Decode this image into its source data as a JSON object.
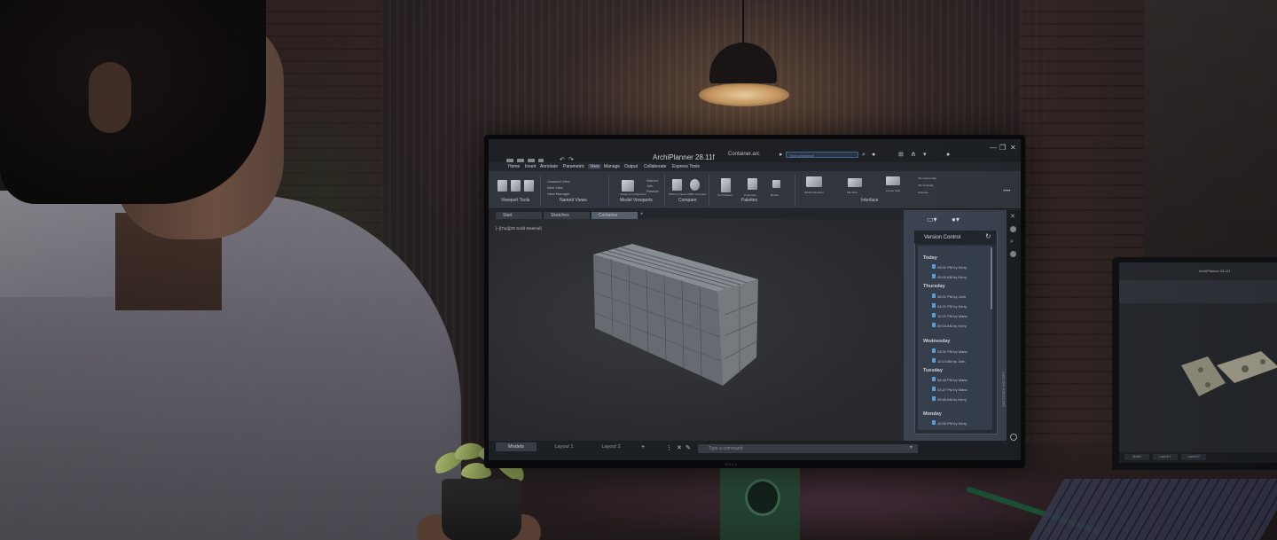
{
  "app": {
    "title": "ArchiPlanner 28.11f",
    "file": "Container.arc",
    "search_placeholder": "Type a keyword",
    "window_controls": [
      "—",
      "❐",
      "✕"
    ]
  },
  "menu": {
    "tabs": [
      "Home",
      "Insert",
      "Annotate",
      "Parametric",
      "View",
      "Manage",
      "Output",
      "Collaborate",
      "Express Tools"
    ],
    "active_tab": "View"
  },
  "ribbon": {
    "viewport_tools_label": "Viewport Tools",
    "named_views": {
      "items": [
        "Unsaved View",
        "New View",
        "View Manager"
      ],
      "label": "Named Views"
    },
    "model_viewports": {
      "label": "Model Viewports",
      "items": [
        "Viewport Configuration",
        "Named",
        "Join",
        "Restore"
      ]
    },
    "compare": {
      "label": "Compare",
      "items": [
        "DWG Compare",
        "XREF Compare"
      ]
    },
    "palettes": {
      "label": "Palettes",
      "items": [
        "Tool Palettes",
        "Properties",
        "Blocks"
      ]
    },
    "interface": {
      "label": "Interface",
      "items": [
        "Switch Windows",
        "File Tabs",
        "Layout Tabs",
        "Tile Horizontally",
        "Tile Vertically",
        "Cascade"
      ]
    }
  },
  "doc_tabs": [
    "Start",
    "Sketches",
    "Container"
  ],
  "active_doc_tab": "Container",
  "viewport": {
    "label": "[−][Top][3D Solid Material]"
  },
  "version_control": {
    "title": "Version Control",
    "groups": [
      {
        "day": "Today",
        "entries": [
          "03:31 PM by Kerry",
          "09:45 AM by Kerry"
        ]
      },
      {
        "day": "Thursday",
        "entries": [
          "06:21 PM by Josh",
          "04:21 PM by Kerry",
          "12:21 PM by Maria",
          "09:03 AM by Kerry"
        ]
      },
      {
        "day": "Wednesday",
        "entries": [
          "03:31 PM by Maria",
          "11:14 AM by Josh"
        ]
      },
      {
        "day": "Tuesday",
        "entries": [
          "06:43 PM by Maria",
          "03:27 PM by Maria",
          "09:45 AM by Kerry"
        ]
      },
      {
        "day": "Monday",
        "entries": [
          "10:30 PM by Kerry"
        ]
      }
    ],
    "sidebar_label": "SKETCHES HISTORY"
  },
  "status": {
    "tabs": [
      "Models",
      "Layout 1",
      "Layout 2"
    ],
    "active": "Models",
    "add": "+",
    "command_placeholder": "Type a command"
  },
  "monitor_brand": "DELL",
  "laptop": {
    "title": "ArchiPlanner 28.11f",
    "status_tabs": [
      "Model",
      "Layout 1",
      "Layout 2"
    ]
  }
}
